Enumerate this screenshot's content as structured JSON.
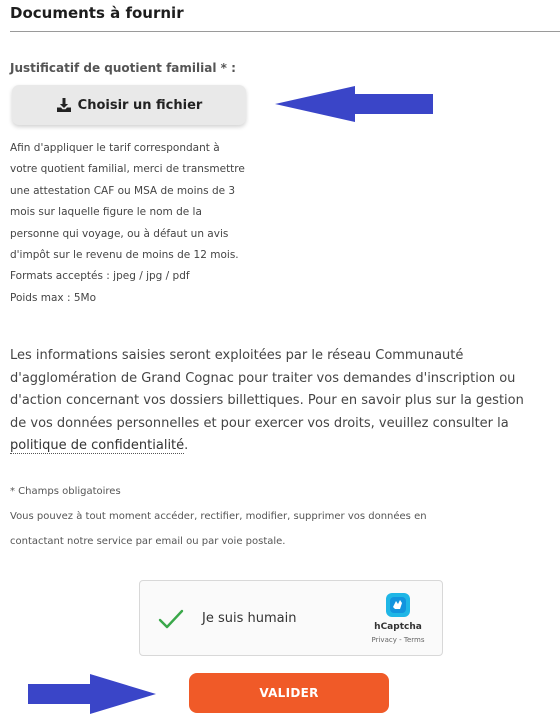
{
  "section": {
    "title": "Documents à fournir"
  },
  "field": {
    "label": "Justificatif de quotient familial * :",
    "upload_button": "Choisir un fichier",
    "upload_icon": "download-icon",
    "help_lines": [
      "Afin d'appliquer le tarif correspondant à",
      "votre quotient familial, merci de transmettre",
      "une attestation CAF ou MSA de moins de 3",
      "mois sur laquelle figure le nom de la",
      "personne qui voyage, ou à défaut un avis",
      "d'impôt sur le revenu de moins de 12 mois.",
      "Formats acceptés : jpeg / jpg / pdf",
      "Poids max : 5Mo"
    ]
  },
  "privacy": {
    "lines": [
      "Les informations saisies seront exploitées par le réseau Communauté",
      "d'agglomération de Grand Cognac pour traiter vos demandes d'inscription ou",
      "d'action concernant vos dossiers billettiques. Pour en savoir plus sur la gestion",
      "de vos données personnelles et pour exercer vos droits, veuillez consulter la"
    ],
    "link": "politique de confidentialité",
    "link_suffix": "."
  },
  "notes": {
    "required": "* Champs obligatoires",
    "rights_lines": [
      "Vous pouvez à tout moment accéder, rectifier, modifier, supprimer vos données en",
      "contactant notre service par email ou par voie postale."
    ]
  },
  "captcha": {
    "label": "Je suis humain",
    "brand": "hCaptcha",
    "privacy": "Privacy",
    "separator": " - ",
    "terms": "Terms"
  },
  "submit": {
    "label": "VALIDER"
  },
  "colors": {
    "accent": "#f05a28",
    "arrow": "#3a45c8",
    "check": "#3aa84a",
    "captcha_logo": "#1fb6e6"
  }
}
